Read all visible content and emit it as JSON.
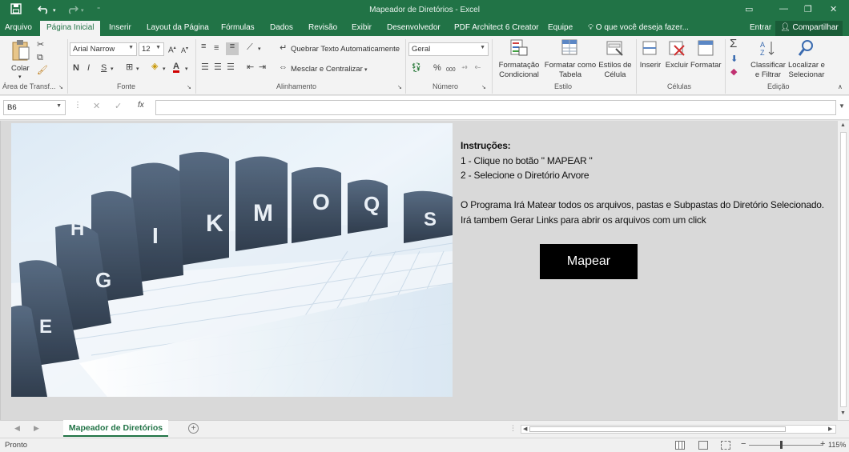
{
  "window": {
    "title": "Mapeador de Diretórios - Excel",
    "buttons": [
      "🗖",
      "—",
      "❐",
      "✕"
    ]
  },
  "quick_access": {
    "save_icon": "save-icon",
    "undo_icon": "undo-icon",
    "redo_icon": "redo-icon"
  },
  "tabs": [
    {
      "label": "Arquivo"
    },
    {
      "label": "Página Inicial"
    },
    {
      "label": "Inserir"
    },
    {
      "label": "Layout da Página"
    },
    {
      "label": "Fórmulas"
    },
    {
      "label": "Dados"
    },
    {
      "label": "Revisão"
    },
    {
      "label": "Exibir"
    },
    {
      "label": "Desenvolvedor"
    },
    {
      "label": "PDF Architect 6 Creator"
    },
    {
      "label": "Equipe"
    }
  ],
  "tell_me": "O que você deseja fazer...",
  "account": {
    "sign_in": "Entrar",
    "share": "Compartilhar"
  },
  "ribbon": {
    "clipboard": {
      "paste": "Colar",
      "label": "Área de Transf..."
    },
    "font": {
      "name": "Arial Narrow",
      "size": "12",
      "bold": "N",
      "italic": "I",
      "underline": "S",
      "label": "Fonte"
    },
    "alignment": {
      "wrap": "Quebrar Texto Automaticamente",
      "merge": "Mesclar e Centralizar",
      "label": "Alinhamento"
    },
    "number": {
      "format": "Geral",
      "percent": "%",
      "thousands": "000",
      "label": "Número"
    },
    "styles": {
      "conditional": [
        "Formatação",
        "Condicional"
      ],
      "table": [
        "Formatar como",
        "Tabela"
      ],
      "cell": [
        "Estilos de",
        "Célula"
      ],
      "label": "Estilo"
    },
    "cells": {
      "insert": "Inserir",
      "delete": "Excluir",
      "format": "Formatar",
      "label": "Células"
    },
    "editing": {
      "sort": [
        "Classificar",
        "e Filtrar"
      ],
      "find": [
        "Localizar e",
        "Selecionar"
      ],
      "label": "Edição"
    }
  },
  "formula_bar": {
    "name_box": "B6",
    "formula": "",
    "fx": "fx"
  },
  "content": {
    "heading": "Instruções:",
    "steps": [
      "1 - Clique no botão \" MAPEAR \"",
      "2 - Selecione o Diretório  Arvore"
    ],
    "paragraph": [
      "O Programa Irá Matear todos os arquivos, pastas e Subpastas do Diretório Selecionado.",
      "Irá tambem Gerar Links para abrir os arquivos com um click"
    ],
    "button": "Mapear",
    "photo_letters": [
      "Q",
      "O",
      "M",
      "K",
      "I",
      "S",
      "H",
      "G",
      "E"
    ]
  },
  "sheet_tabs": [
    {
      "label": "Mapeador de Diretórios",
      "active": true
    }
  ],
  "status": {
    "text": "Pronto",
    "zoom": "115%"
  }
}
